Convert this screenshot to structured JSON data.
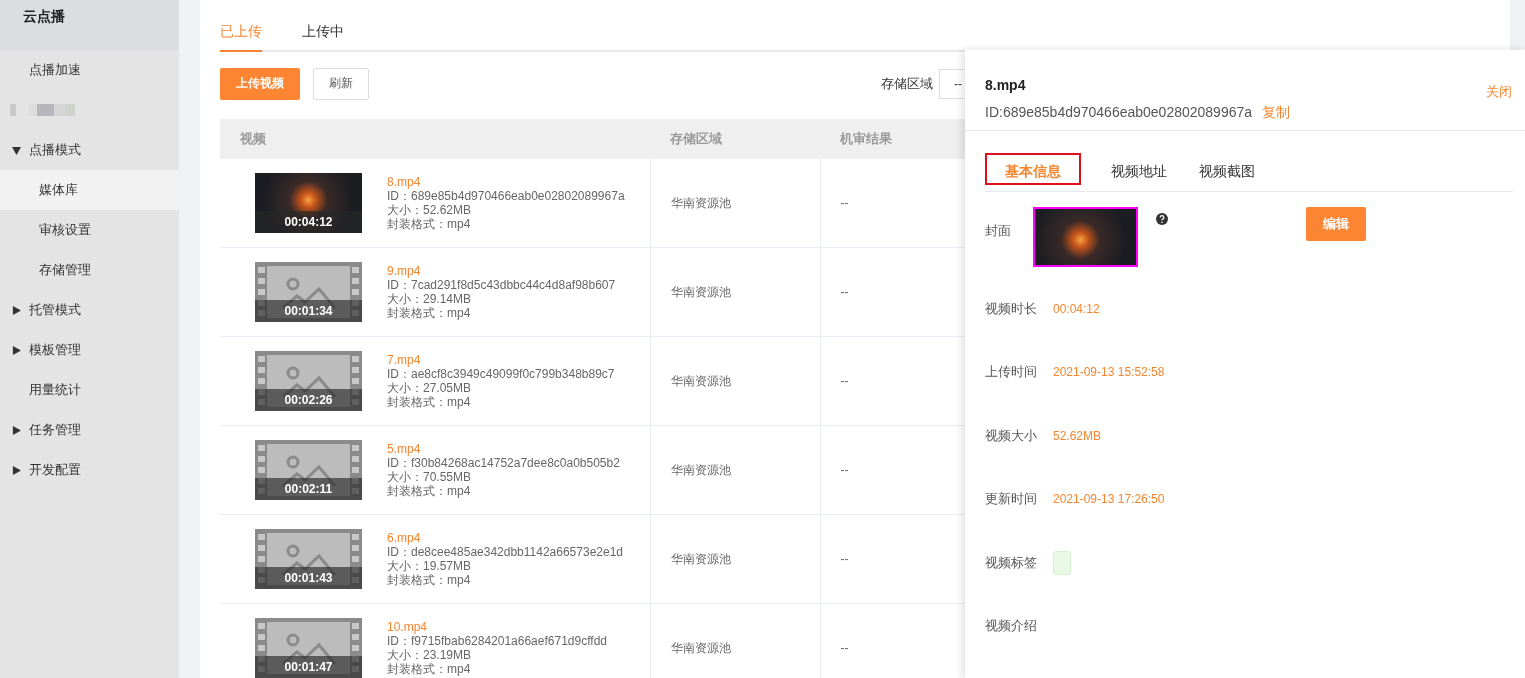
{
  "sidebar": {
    "title": "云点播",
    "items": [
      {
        "kind": "item",
        "label": "点播加速",
        "selected": false
      },
      {
        "kind": "redacted",
        "selected": false
      },
      {
        "kind": "group",
        "label": "点播模式",
        "expanded": true,
        "selected": false
      },
      {
        "kind": "sub",
        "label": "媒体库",
        "selected": true
      },
      {
        "kind": "sub",
        "label": "审核设置",
        "selected": false
      },
      {
        "kind": "sub",
        "label": "存储管理",
        "selected": false
      },
      {
        "kind": "group",
        "label": "托管模式",
        "expanded": false,
        "selected": false
      },
      {
        "kind": "group",
        "label": "模板管理",
        "expanded": false,
        "selected": false
      },
      {
        "kind": "item",
        "label": "用量统计",
        "selected": false
      },
      {
        "kind": "group",
        "label": "任务管理",
        "expanded": false,
        "selected": false
      },
      {
        "kind": "group",
        "label": "开发配置",
        "expanded": false,
        "selected": false
      }
    ]
  },
  "tabs": [
    {
      "label": "已上传",
      "selected": true
    },
    {
      "label": "上传中",
      "selected": false
    }
  ],
  "toolbar": {
    "upload_button": "上传视频",
    "refresh_button": "刷新",
    "region_label": "存储区域",
    "region_value": "--"
  },
  "table": {
    "columns": [
      "视频",
      "存储区域",
      "机审结果"
    ],
    "rows": [
      {
        "kind": "photo",
        "duration": "00:04:12",
        "name": "8.mp4",
        "id": "ID：689e85b4d970466eab0e02802089967a",
        "size": "大小：52.62MB",
        "format": "封装格式：mp4",
        "region": "华南资源池",
        "review": "--"
      },
      {
        "kind": "placeholder",
        "duration": "00:01:34",
        "name": "9.mp4",
        "id": "ID：7cad291f8d5c43dbbc44c4d8af98b607",
        "size": "大小：29.14MB",
        "format": "封装格式：mp4",
        "region": "华南资源池",
        "review": "--"
      },
      {
        "kind": "placeholder",
        "duration": "00:02:26",
        "name": "7.mp4",
        "id": "ID：ae8cf8c3949c49099f0c799b348b89c7",
        "size": "大小：27.05MB",
        "format": "封装格式：mp4",
        "region": "华南资源池",
        "review": "--"
      },
      {
        "kind": "placeholder",
        "duration": "00:02:11",
        "name": "5.mp4",
        "id": "ID：f30b84268ac14752a7dee8c0a0b505b2",
        "size": "大小：70.55MB",
        "format": "封装格式：mp4",
        "region": "华南资源池",
        "review": "--"
      },
      {
        "kind": "placeholder",
        "duration": "00:01:43",
        "name": "6.mp4",
        "id": "ID：de8cee485ae342dbb1142a66573e2e1d",
        "size": "大小：19.57MB",
        "format": "封装格式：mp4",
        "region": "华南资源池",
        "review": "--"
      },
      {
        "kind": "placeholder",
        "duration": "00:01:47",
        "name": "10.mp4",
        "id": "ID：f9715fbab6284201a66aef671d9cffdd",
        "size": "大小：23.19MB",
        "format": "封装格式：mp4",
        "region": "华南资源池",
        "review": "--"
      }
    ]
  },
  "detail": {
    "title": "8.mp4",
    "id": "ID:689e85b4d970466eab0e02802089967a",
    "copy_link": "复制",
    "close_link": "关闭",
    "tabs": [
      {
        "label": "基本信息",
        "selected": true
      },
      {
        "label": "视频地址",
        "selected": false
      },
      {
        "label": "视频截图",
        "selected": false
      }
    ],
    "cover_label": "封面",
    "edit_button": "编辑",
    "fields": [
      {
        "kind": "text",
        "label": "视频时长",
        "value": "00:04:12"
      },
      {
        "kind": "text",
        "label": "上传时间",
        "value": "2021-09-13 15:52:58"
      },
      {
        "kind": "text",
        "label": "视频大小",
        "value": "52.62MB"
      },
      {
        "kind": "text",
        "label": "更新时间",
        "value": "2021-09-13 17:26:50"
      },
      {
        "kind": "tag",
        "label": "视频标签"
      },
      {
        "kind": "empty",
        "label": "视频介绍"
      }
    ]
  }
}
